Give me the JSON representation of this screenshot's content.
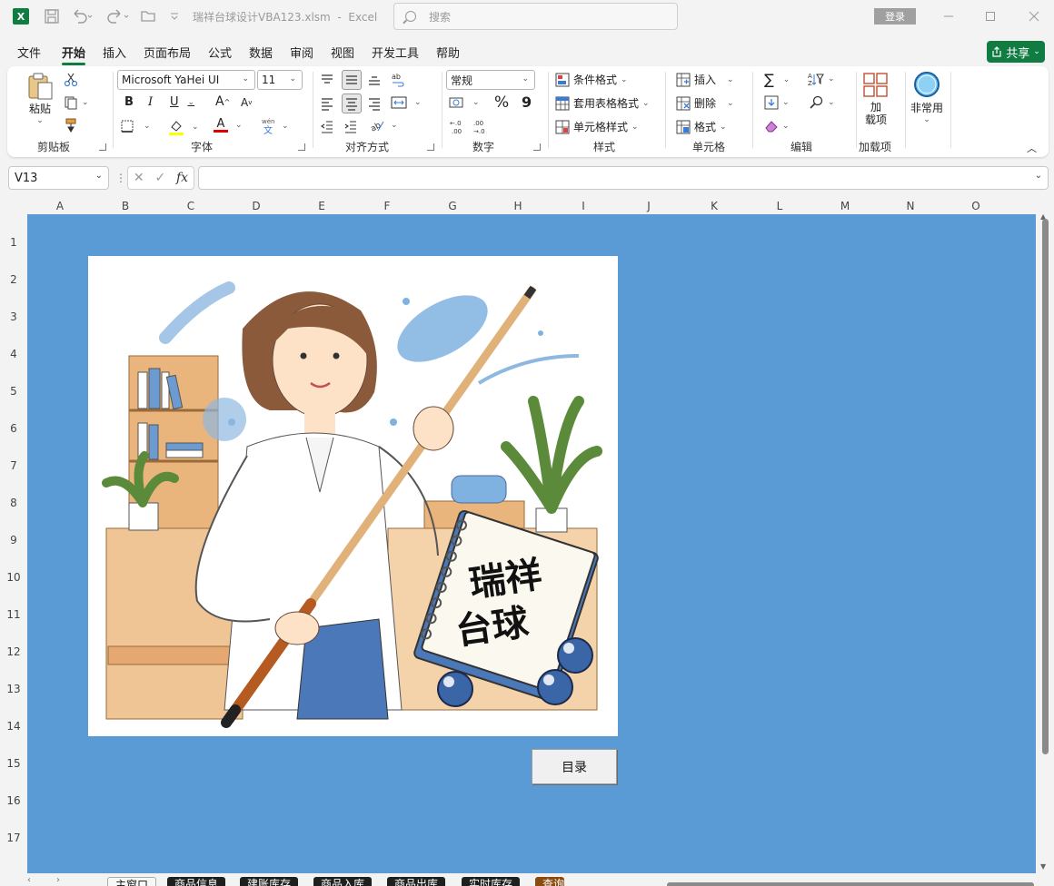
{
  "title_bar": {
    "app_icon": "X",
    "filename": "瑞祥台球设计VBA123.xlsm",
    "separator": "-",
    "app_name": "Excel",
    "search_placeholder": "搜索",
    "login_label": "登录"
  },
  "menu": {
    "tabs": [
      "文件",
      "开始",
      "插入",
      "页面布局",
      "公式",
      "数据",
      "审阅",
      "视图",
      "开发工具",
      "帮助"
    ],
    "active_tab": "开始",
    "share_label": "共享"
  },
  "ribbon": {
    "clipboard": {
      "paste_label": "粘贴",
      "group_label": "剪贴板"
    },
    "font": {
      "font_name": "Microsoft YaHei UI",
      "font_size": "11",
      "bold": "B",
      "italic": "I",
      "underline": "U",
      "grow": "A",
      "shrink": "A",
      "group_label": "字体"
    },
    "alignment": {
      "group_label": "对齐方式"
    },
    "number": {
      "format": "常规",
      "percent": "%",
      "comma": "9",
      "group_label": "数字"
    },
    "styles": {
      "conditional": "条件格式",
      "table": "套用表格格式",
      "cell_style": "单元格样式",
      "group_label": "样式"
    },
    "cells": {
      "insert": "插入",
      "delete": "删除",
      "format": "格式",
      "group_label": "单元格"
    },
    "editing": {
      "group_label": "编辑"
    },
    "addins": {
      "label_line1": "加",
      "label_line2": "载项",
      "group_label": "加载项"
    },
    "uncommon": {
      "label": "非常用"
    },
    "icon_colors": {
      "fill_highlight": "#ffff00",
      "font_color": "#e00000"
    }
  },
  "formula_bar": {
    "name_box": "V13",
    "fx": "fx",
    "formula": ""
  },
  "grid": {
    "columns": [
      "A",
      "B",
      "C",
      "D",
      "E",
      "F",
      "G",
      "H",
      "I",
      "J",
      "K",
      "L",
      "M",
      "N",
      "O"
    ],
    "rows": [
      "1",
      "2",
      "3",
      "4",
      "5",
      "6",
      "7",
      "8",
      "9",
      "10",
      "11",
      "12",
      "13",
      "14",
      "15",
      "16",
      "17"
    ],
    "sheet_background": "#5b9bd5"
  },
  "picture": {
    "notebook_text_line1": "瑞祥",
    "notebook_text_line2": "台球"
  },
  "menu_button": {
    "label": "目录"
  },
  "sheet_tabs": [
    {
      "label": "主窗口",
      "active": true
    },
    {
      "label": "商品信息",
      "active": false
    },
    {
      "label": "建账库存",
      "active": false
    },
    {
      "label": "商品入库",
      "active": false
    },
    {
      "label": "商品出库",
      "active": false
    },
    {
      "label": "实时库存",
      "active": false
    },
    {
      "label": "查询",
      "active": false
    }
  ]
}
